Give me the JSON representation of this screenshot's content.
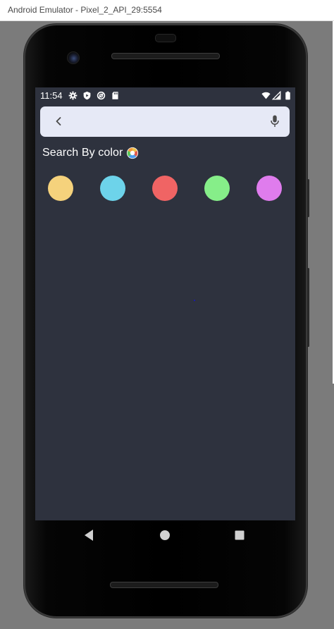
{
  "window": {
    "title": "Android Emulator - Pixel_2_API_29:5554"
  },
  "status_bar": {
    "time": "11:54",
    "left_icons": [
      "gear-icon",
      "shield-play-icon",
      "sync-icon",
      "sd-card-icon"
    ],
    "right_icons": [
      "wifi-icon",
      "cellular-signal-icon",
      "battery-icon"
    ]
  },
  "search": {
    "value": "",
    "placeholder": "",
    "back_icon": "chevron-left-icon",
    "mic_icon": "microphone-icon"
  },
  "section": {
    "title": "Search By color",
    "icon": "color-wheel-icon"
  },
  "colors": [
    {
      "hex": "#f5d27c"
    },
    {
      "hex": "#6dd3ea"
    },
    {
      "hex": "#f06464"
    },
    {
      "hex": "#86ee89"
    },
    {
      "hex": "#df7ced"
    }
  ],
  "navigation": [
    "back-triangle-icon",
    "home-circle-icon",
    "recents-square-icon"
  ],
  "theme": {
    "screen_bg": "#2e323e",
    "search_bg": "#e6e9f6",
    "text": "#ffffff"
  }
}
